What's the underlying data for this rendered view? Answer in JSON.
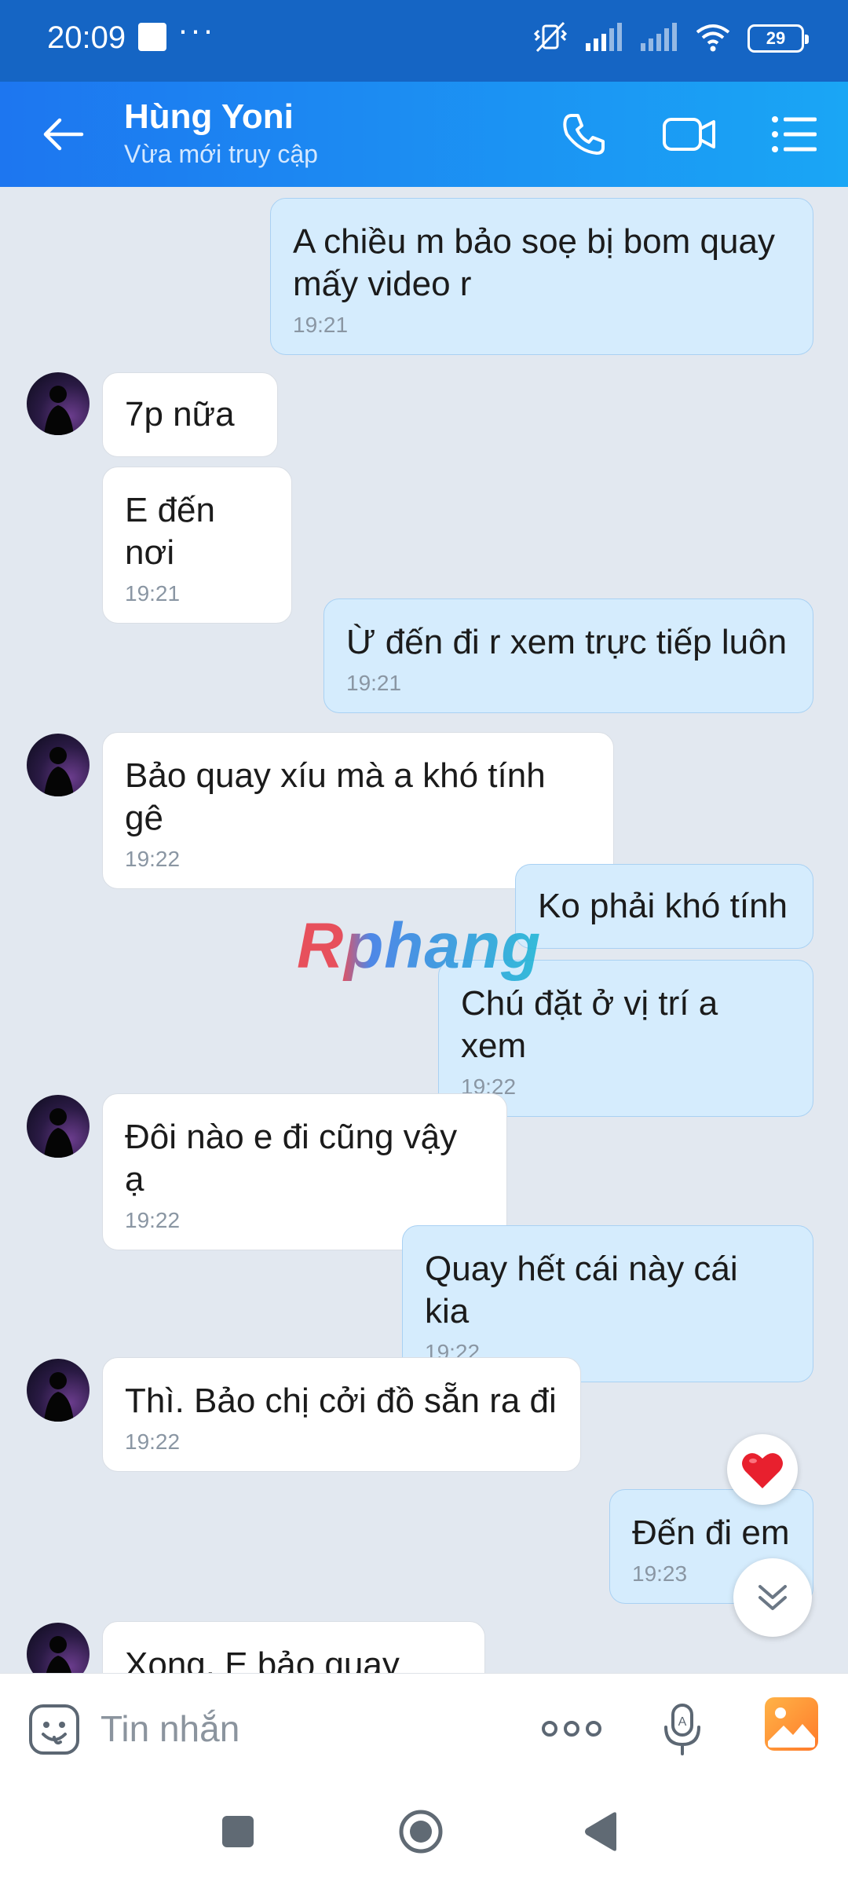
{
  "status_bar": {
    "time": "20:09",
    "dots": "···",
    "battery": "29"
  },
  "header": {
    "contact_name": "Hùng Yoni",
    "status": "Vừa mới truy cập"
  },
  "messages": [
    {
      "direction": "out",
      "text": "A chiều m bảo soẹ bị bom quay mấy video r",
      "time": "19:21"
    },
    {
      "direction": "in",
      "text": "7p nữa",
      "time": ""
    },
    {
      "direction": "in",
      "text": "E đến nơi",
      "time": "19:21"
    },
    {
      "direction": "out",
      "text": "Ừ đến đi r xem trực tiếp luôn",
      "time": "19:21"
    },
    {
      "direction": "in",
      "text": "Bảo quay xíu mà a khó tính gê",
      "time": "19:22"
    },
    {
      "direction": "out",
      "text": "Ko phải khó tính",
      "time": ""
    },
    {
      "direction": "out",
      "text": "Chú đặt ở vị trí a xem",
      "time": "19:22"
    },
    {
      "direction": "in",
      "text": "Đôi nào e đi cũng vậy ạ",
      "time": "19:22"
    },
    {
      "direction": "out",
      "text": "Quay hết cái này cái kia",
      "time": "19:22"
    },
    {
      "direction": "in",
      "text": "Thì. Bảo chị cởi đồ sẵn ra đi",
      "time": "19:22"
    },
    {
      "direction": "out",
      "text": "Đến đi em",
      "time": "19:23"
    },
    {
      "direction": "in",
      "text": "Xong. E bảo quay qua",
      "time": ""
    }
  ],
  "watermark": "Rphang",
  "reaction": {
    "icon": "heart-icon"
  },
  "input": {
    "placeholder": "Tin nhắn",
    "value": ""
  },
  "colors": {
    "header_start": "#1d76f0",
    "header_end": "#1aa6f5",
    "status_bar": "#1565c4",
    "outgoing_bubble": "#d5ecfd",
    "incoming_bubble": "#ffffff",
    "chat_background": "#e2e8f0",
    "timestamp": "#8a96a3"
  }
}
